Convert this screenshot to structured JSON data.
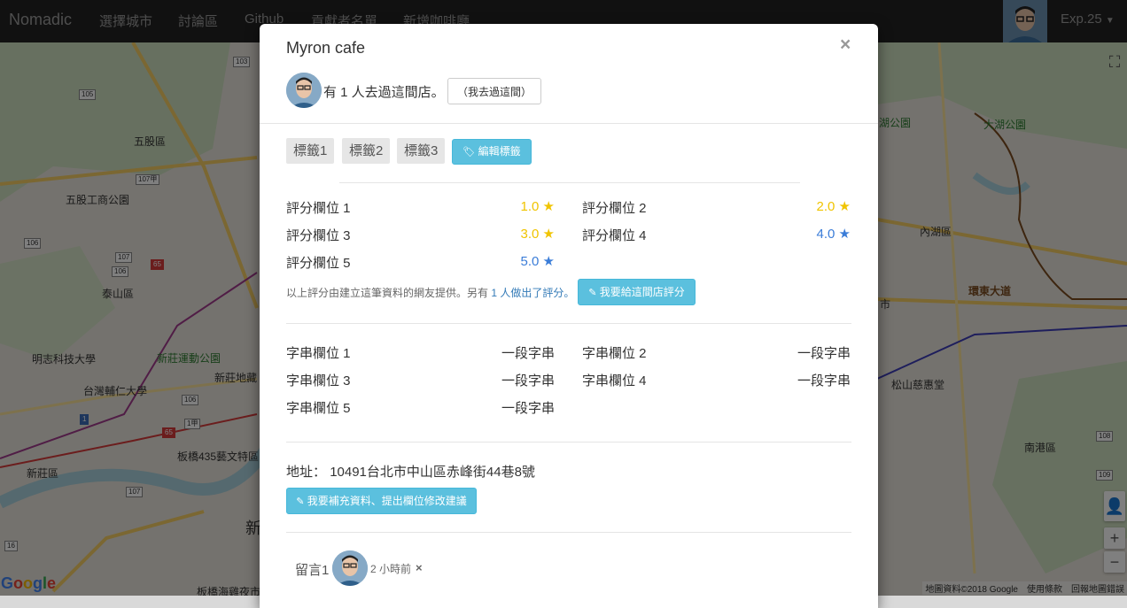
{
  "navbar": {
    "brand": "Nomadic",
    "items": [
      "選擇城市",
      "討論區",
      "Github",
      "貢獻者名單",
      "新增咖啡廳"
    ],
    "user_label": "Exp.25"
  },
  "map": {
    "labels": [
      "五股區",
      "五股工商公園",
      "泰山區",
      "明志科技大學",
      "新莊運動公園",
      "台灣輔仁大學",
      "新莊地藏",
      "板橋435藝文特區",
      "新莊區",
      "湖公園",
      "大湖公園",
      "內湖區",
      "市",
      "松山慈惠堂",
      "南港區",
      "新",
      "板橋海雞夜市"
    ],
    "road_badges": [
      "103",
      "105",
      "107甲",
      "106",
      "107",
      "106",
      "106",
      "107",
      "65",
      "65",
      "1",
      "1甲",
      "108",
      "109",
      "16"
    ],
    "google_logo": "Google",
    "footer": "地圖資料©2018 Google　使用條款　回報地圖錯誤",
    "expressway_label": "環東大道"
  },
  "modal": {
    "title": "Myron cafe",
    "close": "×",
    "visit_text": "有 1 人去過這間店。",
    "visited_button": "（我去過這間）",
    "tags": [
      "標籤1",
      "標籤2",
      "標籤3"
    ],
    "edit_tags_button": "編輯標籤",
    "ratings": [
      {
        "label": "評分欄位 1",
        "value": "1.0 ★",
        "color": "#f0c400"
      },
      {
        "label": "評分欄位 2",
        "value": "2.0 ★",
        "color": "#f0c400"
      },
      {
        "label": "評分欄位 3",
        "value": "3.0 ★",
        "color": "#f0c400"
      },
      {
        "label": "評分欄位 4",
        "value": "4.0 ★",
        "color": "#3b7dd8"
      },
      {
        "label": "評分欄位 5",
        "value": "5.0 ★",
        "color": "#3b7dd8"
      }
    ],
    "rating_note_prefix": "以上評分由建立這筆資料的網友提供。另有 ",
    "rating_note_link": "1 人做出了評分。",
    "rate_button": "我要給這間店評分",
    "strings": [
      {
        "label": "字串欄位 1",
        "value": "一段字串"
      },
      {
        "label": "字串欄位 2",
        "value": "一段字串"
      },
      {
        "label": "字串欄位 3",
        "value": "一段字串"
      },
      {
        "label": "字串欄位 4",
        "value": "一段字串"
      },
      {
        "label": "字串欄位 5",
        "value": "一段字串"
      }
    ],
    "address_label": "地址：",
    "address": "10491台北市中山區赤峰街44巷8號",
    "suggest_button": "我要補充資料、提出欄位修改建議",
    "comment": {
      "label": "留言1",
      "time": "2 小時前",
      "delete": "×"
    }
  },
  "colors": {
    "info_button": "#5bc0de",
    "star_yellow": "#f0c400",
    "star_blue": "#3b7dd8",
    "navbar": "#222222"
  }
}
